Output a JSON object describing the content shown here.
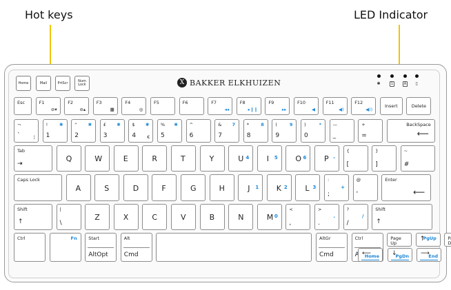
{
  "callouts": {
    "hot_keys": "Hot keys",
    "led": "LED Indicator"
  },
  "brand": {
    "logo_letter": "X",
    "name": "BAKKER ELKHUIZEN"
  },
  "hot_keys": [
    {
      "label": "Home"
    },
    {
      "label": "Mail"
    },
    {
      "label": "PrtScr"
    },
    {
      "label": "Num\nLock"
    }
  ],
  "led_icons": [
    "bluetooth-icon",
    "num-lock-icon",
    "caps-lock-icon",
    "battery-icon"
  ],
  "led_glyphs": [
    "✱",
    "1",
    "A",
    "▯"
  ],
  "colors": {
    "accent": "#1a87d9",
    "leader": "#f2c400",
    "key_border": "#8c8c8c"
  },
  "rows": [
    [
      {
        "w": 26,
        "top_left": "Esc"
      },
      {
        "w": 36,
        "top_left": "F1",
        "bottom_right": "⊘▾"
      },
      {
        "w": 36,
        "top_left": "F2",
        "bottom_right": "⊘▴"
      },
      {
        "w": 36,
        "top_left": "F3",
        "bottom_right": "▦"
      },
      {
        "w": 36,
        "top_left": "F4",
        "bottom_right": "◎"
      },
      {
        "w": 36,
        "top_left": "F5"
      },
      {
        "w": 36,
        "top_left": "F6"
      },
      {
        "w": 36,
        "top_left": "F7",
        "bottom_right": "◂◂",
        "bottom_right_blue": true
      },
      {
        "w": 36,
        "top_left": "F8",
        "bottom_right": "▸❙❙",
        "bottom_right_blue": true
      },
      {
        "w": 36,
        "top_left": "F9",
        "bottom_right": "▸▸",
        "bottom_right_blue": true
      },
      {
        "w": 36,
        "top_left": "F10",
        "bottom_right": "◀",
        "bottom_right_blue": true
      },
      {
        "w": 36,
        "top_left": "F11",
        "bottom_right": "◀)",
        "bottom_right_blue": true
      },
      {
        "w": 36,
        "top_left": "F12",
        "bottom_right": "◀))",
        "bottom_right_blue": true
      },
      {
        "w": 33,
        "center": "Insert"
      },
      {
        "w": 36,
        "center": "Delete"
      }
    ],
    [
      {
        "w": 36,
        "top_left": "¬",
        "bottom_left": "`",
        "bottom_right": "¦"
      },
      {
        "w": 36,
        "top_left": "!",
        "bottom_left": "1",
        "top_right": "✱",
        "top_right_blue": true
      },
      {
        "w": 36,
        "top_left": "\"",
        "bottom_left": "2",
        "top_right": "✱",
        "top_right_blue": true
      },
      {
        "w": 36,
        "top_left": "£",
        "bottom_left": "3",
        "top_right": "✱",
        "top_right_blue": true
      },
      {
        "w": 36,
        "top_left": "$",
        "bottom_left": "4",
        "top_right": "✱",
        "top_right_blue": true,
        "bottom_right": "€"
      },
      {
        "w": 36,
        "top_left": "%",
        "bottom_left": "5",
        "top_right": "✱",
        "top_right_blue": true
      },
      {
        "w": 36,
        "top_left": "^",
        "bottom_left": "6"
      },
      {
        "w": 36,
        "top_left": "&",
        "bottom_left": "7",
        "top_right": "7",
        "top_right_blue": true
      },
      {
        "w": 36,
        "top_left": "*",
        "bottom_left": "8",
        "top_right": "8",
        "top_right_blue": true
      },
      {
        "w": 36,
        "top_left": "(",
        "bottom_left": "9",
        "top_right": "9",
        "top_right_blue": true
      },
      {
        "w": 36,
        "top_left": ")",
        "bottom_left": "0",
        "top_right": "*",
        "top_right_blue": true
      },
      {
        "w": 36,
        "top_left": "—",
        "bottom_left": "_"
      },
      {
        "w": 36,
        "top_left": "+",
        "bottom_left": "="
      },
      {
        "w": 70,
        "top_right": "BackSpace",
        "arrow": "left"
      }
    ],
    [
      {
        "w": 56,
        "top_left": "Tab",
        "arrow": "tab"
      },
      {
        "w": 36,
        "center_big": "Q"
      },
      {
        "w": 36,
        "center_big": "W"
      },
      {
        "w": 36,
        "center_big": "E"
      },
      {
        "w": 36,
        "center_big": "R"
      },
      {
        "w": 36,
        "center_big": "T"
      },
      {
        "w": 36,
        "center_big": "Y"
      },
      {
        "w": 36,
        "center_big": "U",
        "right_blue": "4"
      },
      {
        "w": 36,
        "center_big": "I",
        "right_blue": "5"
      },
      {
        "w": 36,
        "center_big": "O",
        "right_blue": "6"
      },
      {
        "w": 36,
        "center_big": "P",
        "right_blue": "-"
      },
      {
        "w": 36,
        "top_left": "{",
        "bottom_left": "["
      },
      {
        "w": 36,
        "top_left": "}",
        "bottom_left": "]"
      },
      {
        "w": 50,
        "top_left": "~",
        "bottom_left": "#"
      }
    ],
    [
      {
        "w": 70,
        "top_left": "Caps Lock"
      },
      {
        "w": 36,
        "center_big": "A"
      },
      {
        "w": 36,
        "center_big": "S"
      },
      {
        "w": 36,
        "center_big": "D"
      },
      {
        "w": 36,
        "center_big": "F"
      },
      {
        "w": 36,
        "center_big": "G"
      },
      {
        "w": 36,
        "center_big": "H"
      },
      {
        "w": 36,
        "center_big": "J",
        "right_blue": "1"
      },
      {
        "w": 36,
        "center_big": "K",
        "right_blue": "2"
      },
      {
        "w": 36,
        "center_big": "L",
        "right_blue": "3"
      },
      {
        "w": 36,
        "top_left": ":",
        "bottom_left": ";",
        "right_blue": "+"
      },
      {
        "w": 36,
        "top_left": "@",
        "bottom_left": "'"
      },
      {
        "w": 72,
        "top_left": "Enter",
        "arrow": "enter"
      }
    ],
    [
      {
        "w": 56,
        "top_left": "Shift",
        "arrow": "shift"
      },
      {
        "w": 36,
        "top_left": "|",
        "bottom_left": "\\"
      },
      {
        "w": 36,
        "center_big": "Z"
      },
      {
        "w": 36,
        "center_big": "X"
      },
      {
        "w": 36,
        "center_big": "C"
      },
      {
        "w": 36,
        "center_big": "V"
      },
      {
        "w": 36,
        "center_big": "B"
      },
      {
        "w": 36,
        "center_big": "N"
      },
      {
        "w": 36,
        "center_big": "M",
        "right_blue": "0"
      },
      {
        "w": 36,
        "top_left": "<",
        "bottom_left": ","
      },
      {
        "w": 36,
        "top_left": ">",
        "bottom_left": ".",
        "right_blue": "."
      },
      {
        "w": 36,
        "top_left": "?",
        "bottom_left": "/",
        "right_blue": "/"
      },
      {
        "w": 88,
        "top_left": "Shift",
        "arrow": "shift"
      }
    ],
    [
      {
        "w": 46,
        "top_left": "Ctrl"
      },
      {
        "w": 46,
        "top_right": "Fn",
        "top_right_blue": true
      },
      {
        "w": 46,
        "top_left": "Start",
        "bottom_left": "AltOpt",
        "divider": true
      },
      {
        "w": 46,
        "top_left": "Alt",
        "bottom_left": "Cmd",
        "divider": true
      },
      {
        "w": 226,
        "center": ""
      },
      {
        "w": 46,
        "top_left": "AltGr",
        "bottom_left": "Cmd",
        "divider": true
      },
      {
        "w": 46,
        "top_left": "Ctrl",
        "bottom_left": "AltOpt",
        "divider": true
      },
      {
        "w": 36,
        "top_left": "Page\nUp"
      },
      {
        "w": 36,
        "top_right": "PgUp",
        "top_right_blue": true,
        "arrow": "up"
      },
      {
        "w": 36,
        "top_left": "Page\nDown"
      }
    ]
  ],
  "arrow_row": [
    {
      "label": "Home",
      "arrow": "left"
    },
    {
      "label": "PgDn",
      "arrow": "down"
    },
    {
      "label": "End",
      "arrow": "right"
    }
  ]
}
